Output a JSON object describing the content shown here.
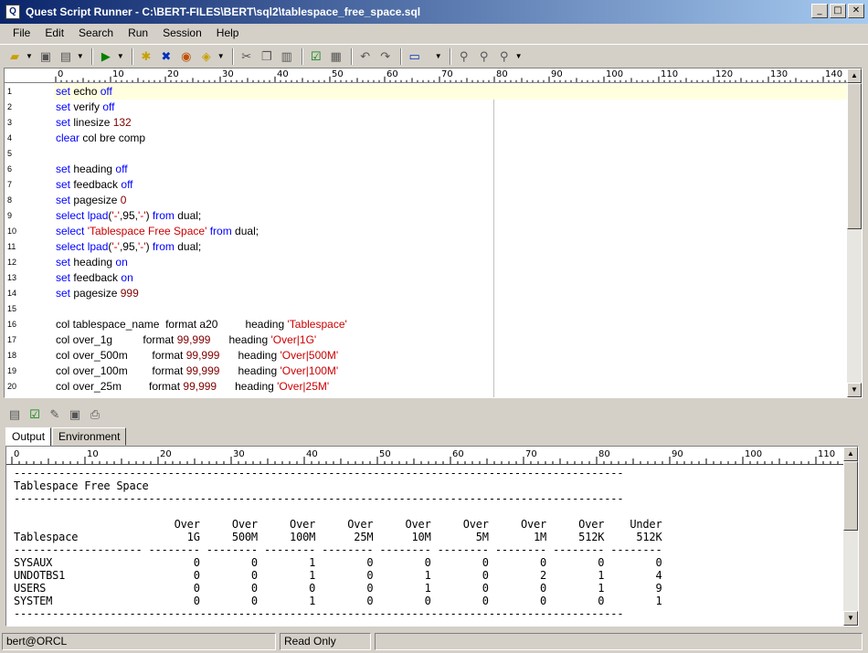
{
  "window": {
    "title": "Quest Script Runner - C:\\BERT-FILES\\BERT\\sql2\\tablespace_free_space.sql"
  },
  "menu": [
    "File",
    "Edit",
    "Search",
    "Run",
    "Session",
    "Help"
  ],
  "editor": {
    "ruler_ticks": [
      "0",
      "10",
      "20",
      "30",
      "40",
      "50",
      "60",
      "70",
      "80",
      "90",
      "100",
      "110",
      "120",
      "130",
      "140"
    ],
    "lines": [
      {
        "n": "1",
        "t": "<span class='kw'>set</span> echo <span class='kw'>off</span>"
      },
      {
        "n": "2",
        "t": "<span class='kw'>set</span> verify <span class='kw'>off</span>"
      },
      {
        "n": "3",
        "t": "<span class='kw'>set</span> linesize <span class='num'>132</span>"
      },
      {
        "n": "4",
        "t": "<span class='kw'>clear</span> col bre comp"
      },
      {
        "n": "5",
        "t": ""
      },
      {
        "n": "6",
        "t": "<span class='kw'>set</span> heading <span class='kw'>off</span>"
      },
      {
        "n": "7",
        "t": "<span class='kw'>set</span> feedback <span class='kw'>off</span>"
      },
      {
        "n": "8",
        "t": "<span class='kw'>set</span> pagesize <span class='num'>0</span>"
      },
      {
        "n": "9",
        "t": "<span class='kw'>select</span> <span class='kw'>lpad</span>(<span class='str'>'-'</span>,95,<span class='str'>'-'</span>) <span class='kw'>from</span> dual;"
      },
      {
        "n": "10",
        "t": "<span class='kw'>select</span> <span class='str'>'Tablespace Free Space'</span> <span class='kw'>from</span> dual;"
      },
      {
        "n": "11",
        "t": "<span class='kw'>select</span> <span class='kw'>lpad</span>(<span class='str'>'-'</span>,95,<span class='str'>'-'</span>) <span class='kw'>from</span> dual;"
      },
      {
        "n": "12",
        "t": "<span class='kw'>set</span> heading <span class='kw'>on</span>"
      },
      {
        "n": "13",
        "t": "<span class='kw'>set</span> feedback <span class='kw'>on</span>"
      },
      {
        "n": "14",
        "t": "<span class='kw'>set</span> pagesize <span class='num'>999</span>"
      },
      {
        "n": "15",
        "t": ""
      },
      {
        "n": "16",
        "t": "col tablespace_name  format a20         heading <span class='str'>'Tablespace'</span>"
      },
      {
        "n": "17",
        "t": "col over_1g          format <span class='num'>99,999</span>      heading <span class='str'>'Over|1G'</span>"
      },
      {
        "n": "18",
        "t": "col over_500m        format <span class='num'>99,999</span>      heading <span class='str'>'Over|500M'</span>"
      },
      {
        "n": "19",
        "t": "col over_100m        format <span class='num'>99,999</span>      heading <span class='str'>'Over|100M'</span>"
      },
      {
        "n": "20",
        "t": "col over_25m         format <span class='num'>99,999</span>      heading <span class='str'>'Over|25M'</span>"
      }
    ]
  },
  "tabs": [
    "Output",
    "Environment"
  ],
  "output": {
    "ruler_ticks": [
      "0",
      "10",
      "20",
      "30",
      "40",
      "50",
      "60",
      "70",
      "80",
      "90",
      "100",
      "110"
    ],
    "lines": [
      "-----------------------------------------------------------------------------------------------",
      "Tablespace Free Space",
      "-----------------------------------------------------------------------------------------------",
      "",
      "                         Over     Over     Over     Over     Over     Over     Over     Over    Under",
      "Tablespace                 1G     500M     100M      25M      10M       5M       1M     512K     512K",
      "-------------------- -------- -------- -------- -------- -------- -------- -------- -------- --------",
      "SYSAUX                      0        0        1        0        0        0        0        0        0",
      "UNDOTBS1                    0        0        1        0        1        0        2        1        4",
      "USERS                       0        0        0        0        1        0        0        1        9",
      "SYSTEM                      0        0        1        0        0        0        0        0        1",
      "-----------------------------------------------------------------------------------------------"
    ]
  },
  "status": {
    "connection": "bert@ORCL",
    "mode": "Read Only",
    "extra": ""
  }
}
